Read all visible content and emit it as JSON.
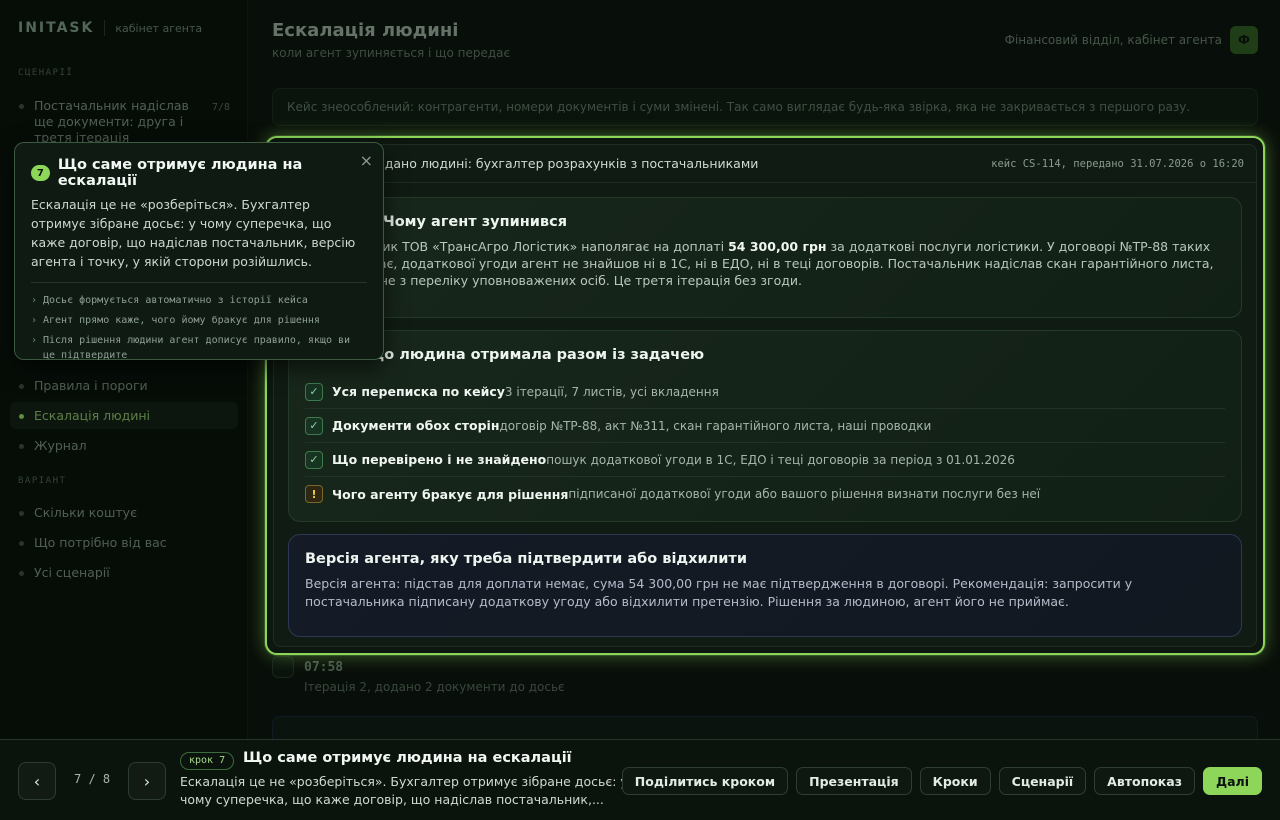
{
  "brand": {
    "logo": "INITASK",
    "subtitle": "кабінет агента"
  },
  "sidebar": {
    "section_scenarios": "СЦЕНАРІЇ",
    "scenario_item": {
      "label": "Постачальник надіслав ще документи: друга і третя ітерація",
      "badge": "7/8"
    },
    "nav_items": [
      {
        "label": "Правила і пороги"
      },
      {
        "label": "Ескалація людині",
        "active": true
      },
      {
        "label": "Журнал"
      }
    ],
    "section_more": "ВАРІАНТ",
    "more_items": [
      {
        "label": "Скільки коштує"
      },
      {
        "label": "Що потрібно від вас"
      },
      {
        "label": "Усі сценарії"
      }
    ]
  },
  "header": {
    "title": "Ескалація людині",
    "subtitle": "коли агент зупиняється і що передає",
    "right_label": "Фінансовий відділ, кабінет агента",
    "avatar": "Ф"
  },
  "notice": "Кейс знеособлений: контрагенти, номери документів і суми змінені. Так само виглядає будь-яка звірка, яка не закривається з першого разу.",
  "card": {
    "head_title": "Передано людині: бухгалтер розрахунків з постачальниками",
    "head_meta": "кейс CS-114, передано 31.07.2026 о 16:20",
    "why": {
      "title": "Чому агент зупинився",
      "text_a": "Постачальник ТОВ «ТрансАгро Логістик» наполягає на доплаті ",
      "amount": "54 300,00 грн",
      "text_b": " за додаткові послуги логістики. У договорі №ТР-88 таких послуг немає, додаткової угоди агент не знайшов ні в 1С, ні в ЕДО, ні в теці договорів. Постачальник надіслав скан гарантійного листа, але підпис не з переліку уповноважених осіб. Це третя ітерація без згоди."
    },
    "received": {
      "title": "Що людина отримала разом із задачею",
      "items": [
        {
          "icon": "✓",
          "title": "Уся переписка по кейсу",
          "desc": "3 ітерації, 7 листів, усі вкладення",
          "warn": false
        },
        {
          "icon": "✓",
          "title": "Документи обох сторін",
          "desc": "договір №ТР-88, акт №311, скан гарантійного листа, наші проводки",
          "warn": false
        },
        {
          "icon": "✓",
          "title": "Що перевірено і не знайдено",
          "desc": "пошук додаткової угоди в 1С, ЕДО і теці договорів за період з 01.01.2026",
          "warn": false
        },
        {
          "icon": "!",
          "title": "Чого агенту бракує для рішення",
          "desc": "підписаної додаткової угоди або вашого рішення визнати послуги без неї",
          "warn": true
        }
      ]
    },
    "version": {
      "title": "Версія агента, яку треба підтвердити або відхилити",
      "text": "Версія агента: підстав для доплати немає, сума 54 300,00 грн не має підтвердження в договорі. Рекомендація: запросити у постачальника підписану додаткову угоду або відхилити претензію. Рішення за людиною, агент його не приймає."
    }
  },
  "timeline": {
    "time": "07:58",
    "text": "Ітерація 2, додано 2 документи до досьє"
  },
  "tooltip": {
    "num": "7",
    "title": "Що саме отримує людина на ескалації",
    "close": "×",
    "body": "Ескалація це не «розберіться». Бухгалтер отримує зібране досьє: у чому суперечка, що каже договір, що надіслав постачальник, версію агента і точку, у якій сторони розійшлись.",
    "bullets": [
      "Досьє формується автоматично з історії кейса",
      "Агент прямо каже, чого йому бракує для рішення",
      "Після рішення людини агент дописує правило, якщо ви це підтвердите"
    ]
  },
  "bottombar": {
    "prev": "‹",
    "next": "›",
    "counter": "7 / 8",
    "step_tag": "крок 7",
    "step_title": "Що саме отримує людина на ескалації",
    "step_desc": "Ескалація це не «розберіться». Бухгалтер отримує зібране досьє: у чому суперечка, що каже договір, що надіслав постачальник,...",
    "actions": [
      "Поділитись кроком",
      "Презентація",
      "Кроки",
      "Сценарії",
      "Автопоказ"
    ],
    "next_label": "Далі"
  },
  "colors": {
    "accent": "#8dd65a",
    "warn": "#f0c84a",
    "bg": "#0b120d"
  }
}
